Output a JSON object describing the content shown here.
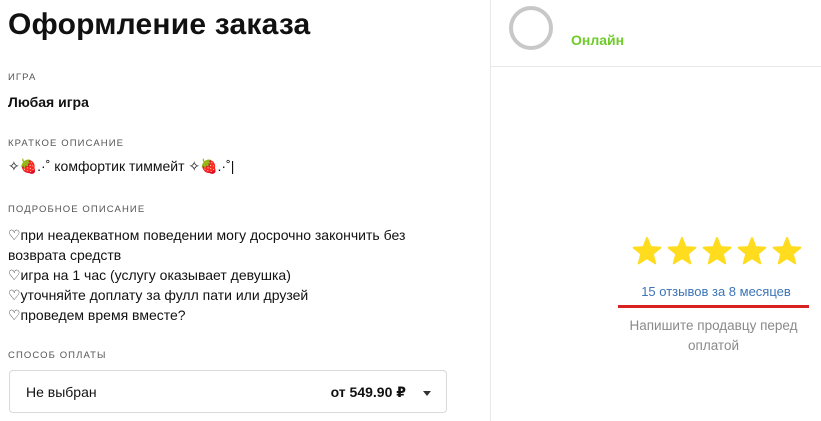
{
  "page": {
    "title": "Оформление заказа"
  },
  "game": {
    "label": "ИГРА",
    "value": "Любая игра"
  },
  "short_description": {
    "label": "КРАТКОЕ ОПИСАНИЕ",
    "value": "✧🍓.·˚ комфортик тиммейт ✧🍓.·˚|"
  },
  "full_description": {
    "label": "ПОДРОБНОЕ ОПИСАНИЕ",
    "lines": [
      "♡при неадекватном поведении могу досрочно закончить без",
      "возврата средств",
      "♡игра на 1 час (услугу оказывает девушка)",
      "♡уточняйте доплату за фулл пати или друзей",
      "♡проведем время вместе?"
    ]
  },
  "payment": {
    "label": "СПОСОБ ОПЛАТЫ",
    "selected": "Не выбран",
    "price": "от 549.90 ₽"
  },
  "seller": {
    "status": "Онлайн",
    "rating": 5,
    "reviews_link": "15 отзывов за 8 месяцев",
    "hint": "Напишите продавцу перед оплатой"
  },
  "colors": {
    "online": "#6ecb2a",
    "star": "#ffdc1e",
    "link": "#3b74b8",
    "underline": "#d9211f"
  }
}
